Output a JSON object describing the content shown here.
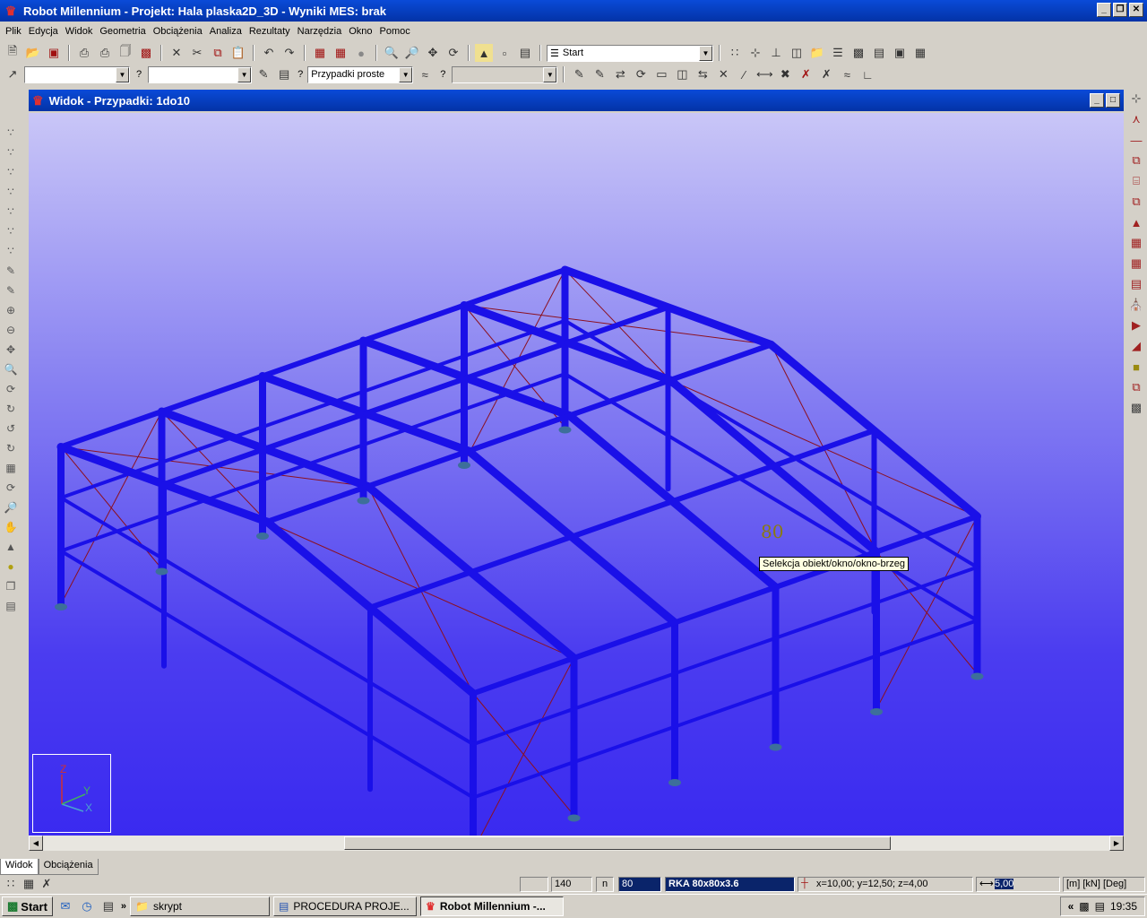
{
  "app": {
    "title": "Robot Millennium - Projekt: Hala plaska2D_3D - Wyniki MES: brak",
    "icon": "robot-logo-icon"
  },
  "menu": [
    "Plik",
    "Edycja",
    "Widok",
    "Geometria",
    "Obciążenia",
    "Analiza",
    "Rezultaty",
    "Narzędzia",
    "Okno",
    "Pomoc"
  ],
  "toolbar1": {
    "layout_select": "Start"
  },
  "toolbar2": {
    "selection_label": "?",
    "cases_label": "?",
    "cases_select": "Przypadki proste",
    "mode_label": "?"
  },
  "view": {
    "title": "Widok - Przypadki: 1do10",
    "marker_label": "80",
    "tooltip": "Selekcja obiekt/okno/okno-brzeg",
    "axes": {
      "z": "Z",
      "y": "Y",
      "x": "X"
    }
  },
  "tabs": [
    "Widok",
    "Obciążenia"
  ],
  "status": {
    "node_count": "140",
    "n_label": "n",
    "bar_number": "80",
    "section": "RKA 80x80x3.6",
    "coordinates": "x=10,00; y=12,50; z=4,00",
    "value": "5,00",
    "units": "[m] [kN] [Deg]"
  },
  "taskbar": {
    "start": "Start",
    "tasks": [
      "skrypt",
      "PROCEDURA PROJE...",
      "Robot Millennium -..."
    ],
    "time": "19:35"
  },
  "colors": {
    "titlebar": "#0a4bd8",
    "beam": "#1a10e8",
    "brace": "#8b1020",
    "support": "#3d6f9a"
  }
}
